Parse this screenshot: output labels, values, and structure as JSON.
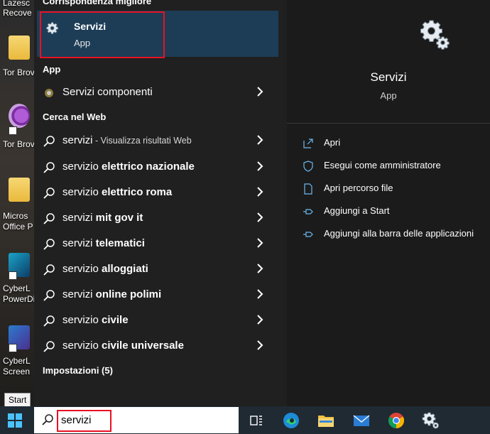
{
  "desktop": {
    "icons": [
      {
        "label_1": "Lazesc",
        "label_2": "Recove"
      },
      {
        "label_1": "Tor Brov",
        "label_2": ""
      },
      {
        "label_1": "Tor Brov",
        "label_2": ""
      },
      {
        "label_1": "Micros",
        "label_2": "Office P"
      },
      {
        "label_1": "CyberL",
        "label_2": "PowerDi"
      },
      {
        "label_1": "CyberL",
        "label_2": "Screen"
      }
    ],
    "start_tooltip": "Start"
  },
  "start_menu": {
    "best_match_header": "Corrispondenza migliore",
    "best_match": {
      "title": "Servizi",
      "subtitle": "App",
      "icon": "gear-icon"
    },
    "app_section": "App",
    "app_items": [
      {
        "label": "Servizi componenti",
        "icon": "component-services-icon"
      }
    ],
    "web_section": "Cerca nel Web",
    "web_items": [
      {
        "prefix": "servizi",
        "bold": "",
        "hint": " - Visualizza risultati Web"
      },
      {
        "prefix": "servizio ",
        "bold": "elettrico nazionale",
        "hint": ""
      },
      {
        "prefix": "servizio ",
        "bold": "elettrico roma",
        "hint": ""
      },
      {
        "prefix": "servizi ",
        "bold": "mit gov it",
        "hint": ""
      },
      {
        "prefix": "servizi ",
        "bold": "telematici",
        "hint": ""
      },
      {
        "prefix": "servizio ",
        "bold": "alloggiati",
        "hint": ""
      },
      {
        "prefix": "servizi ",
        "bold": "online polimi",
        "hint": ""
      },
      {
        "prefix": "servizio ",
        "bold": "civile",
        "hint": ""
      },
      {
        "prefix": "servizio ",
        "bold": "civile universale",
        "hint": ""
      }
    ],
    "settings_section": "Impostazioni (5)"
  },
  "detail_pane": {
    "title": "Servizi",
    "subtitle": "App",
    "actions": [
      {
        "label": "Apri",
        "icon": "open-icon"
      },
      {
        "label": "Esegui come amministratore",
        "icon": "shield-icon"
      },
      {
        "label": "Apri percorso file",
        "icon": "file-location-icon"
      },
      {
        "label": "Aggiungi a Start",
        "icon": "pin-icon"
      },
      {
        "label": "Aggiungi alla barra delle applicazioni",
        "icon": "pin-icon"
      }
    ]
  },
  "taskbar": {
    "search_value": "servizi",
    "icons": [
      "task-view-icon",
      "edge-icon",
      "file-explorer-icon",
      "mail-icon",
      "chrome-icon",
      "services-gear-icon"
    ]
  },
  "colors": {
    "highlight": "#1d3d57",
    "annotation_red": "#e81123",
    "pane_bg": "#202020",
    "detail_bg": "#1b1b1b",
    "taskbar_bg": "#1f2a33"
  }
}
